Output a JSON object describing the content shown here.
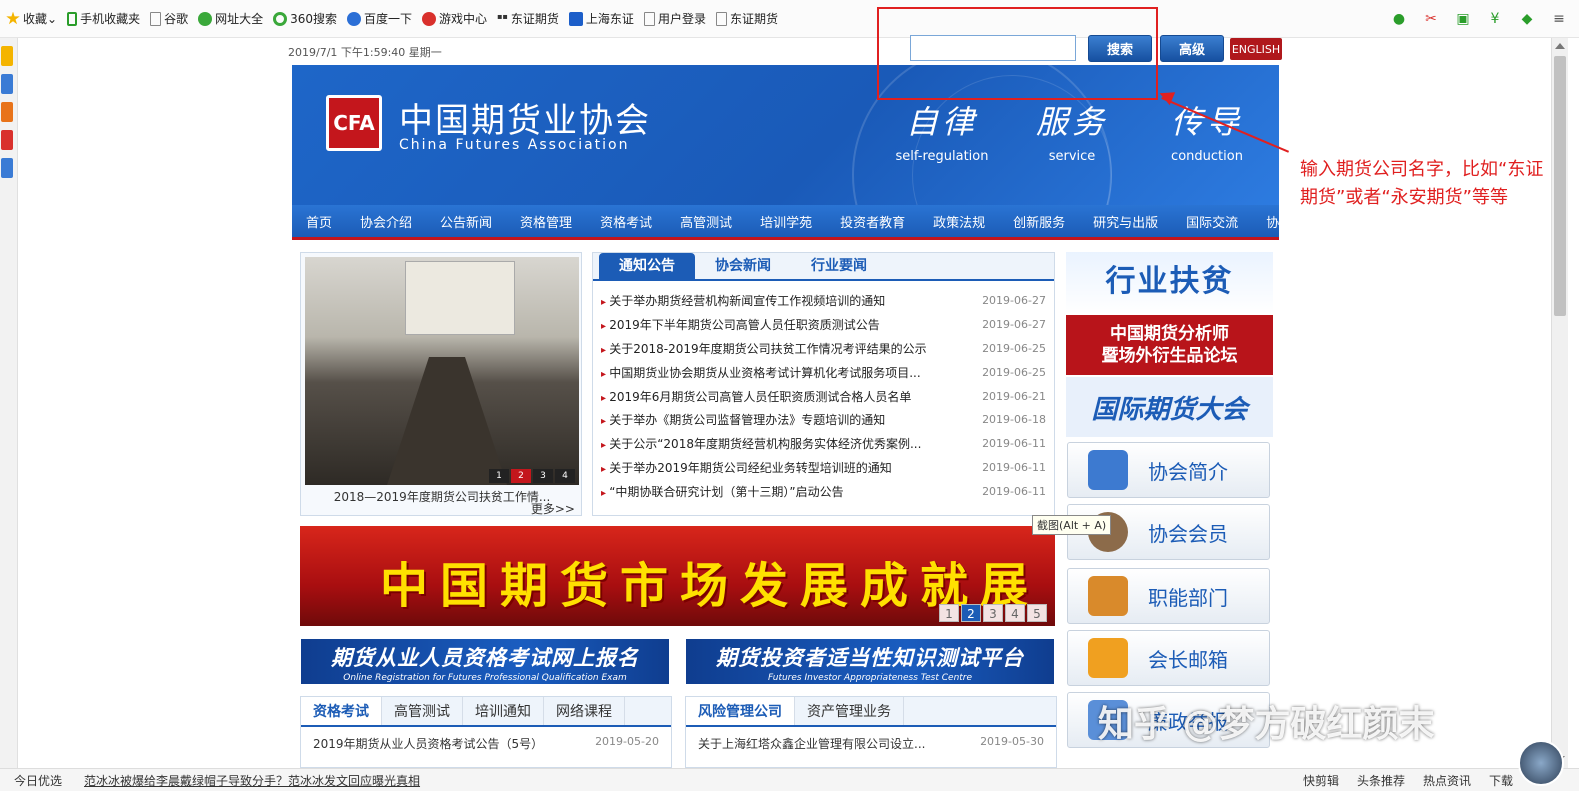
{
  "browser": {
    "favorites": [
      {
        "label": "收藏",
        "icon": "star-icon"
      },
      {
        "label": "手机收藏夹",
        "icon": "phone-icon"
      },
      {
        "label": "谷歌",
        "icon": "page-icon"
      },
      {
        "label": "网址大全",
        "icon": "plus-circle-icon"
      },
      {
        "label": "360搜索",
        "icon": "ring-icon"
      },
      {
        "label": "百度一下",
        "icon": "paw-icon"
      },
      {
        "label": "游戏中心",
        "icon": "game-icon"
      },
      {
        "label": "东证期货",
        "icon": "dz-icon"
      },
      {
        "label": "上海东证",
        "icon": "blue-square-icon"
      },
      {
        "label": "用户登录",
        "icon": "page-icon"
      },
      {
        "label": "东证期货",
        "icon": "page-icon"
      }
    ]
  },
  "site": {
    "datetime": "2019/7/1 下午1:59:40 星期一",
    "search_button": "搜索",
    "advanced_button": "高级",
    "english_button": "ENGLISH",
    "logo_mark": "CFA",
    "org_name_cn": "中国期货业协会",
    "org_name_en": "China Futures Association",
    "slogans": [
      {
        "cn": "自律",
        "en": "self-regulation"
      },
      {
        "cn": "服务",
        "en": "service"
      },
      {
        "cn": "传导",
        "en": "conduction"
      }
    ],
    "nav": [
      "首页",
      "协会介绍",
      "公告新闻",
      "资格管理",
      "资格考试",
      "高管测试",
      "培训学苑",
      "投资者教育",
      "政策法规",
      "创新服务",
      "研究与出版",
      "国际交流",
      "协会邮箱"
    ]
  },
  "feature": {
    "caption": "2018—2019年度期货公司扶贫工作情...",
    "more": "更多>>",
    "pager": [
      "1",
      "2",
      "3",
      "4"
    ],
    "active_page": "2"
  },
  "notices": {
    "tabs": [
      "通知公告",
      "协会新闻",
      "行业要闻"
    ],
    "items": [
      {
        "title": "关于举办期货经营机构新闻宣传工作视频培训的通知",
        "date": "2019-06-27"
      },
      {
        "title": "2019年下半年期货公司高管人员任职资质测试公告",
        "date": "2019-06-27"
      },
      {
        "title": "关于2018-2019年度期货公司扶贫工作情况考评结果的公示",
        "date": "2019-06-25"
      },
      {
        "title": "中国期货业协会期货从业资格考试计算机化考试服务项目...",
        "date": "2019-06-25"
      },
      {
        "title": "2019年6月期货公司高管人员任职资质测试合格人员名单",
        "date": "2019-06-21"
      },
      {
        "title": "关于举办《期货公司监督管理办法》专题培训的通知",
        "date": "2019-06-18"
      },
      {
        "title": "关于公示“2018年度期货经营机构服务实体经济优秀案例...",
        "date": "2019-06-11"
      },
      {
        "title": "关于举办2019年期货公司经纪业务转型培训班的通知",
        "date": "2019-06-11"
      },
      {
        "title": "“中期协联合研究计划（第十三期）”启动公告",
        "date": "2019-06-11"
      }
    ]
  },
  "banner": {
    "text": "中国期货市场发展成就展",
    "pager": [
      "1",
      "2",
      "3",
      "4",
      "5"
    ],
    "active_page": "2"
  },
  "reg_banners": [
    {
      "title": "期货从业人员资格考试网上报名",
      "subtitle": "Online Registration for Futures Professional Qualification Exam"
    },
    {
      "title": "期货投资者适当性知识测试平台",
      "subtitle": "Futures Investor Appropriateness Test Centre"
    }
  ],
  "exam_box": {
    "tabs": [
      "资格考试",
      "高管测试",
      "培训通知",
      "网络课程"
    ],
    "item": {
      "title": "2019年期货从业人员资格考试公告（5号）",
      "date": "2019-05-20"
    }
  },
  "risk_box": {
    "tabs": [
      "风险管理公司",
      "资产管理业务"
    ],
    "item": {
      "title": "关于上海红塔众鑫企业管理有限公司设立...",
      "date": "2019-05-30"
    }
  },
  "right_column": {
    "poverty": "行业扶贫",
    "analyst_line1": "中国期货分析师",
    "analyst_line2": "暨场外衍生品论坛",
    "intl": "国际期货大会",
    "menu": [
      {
        "label": "协会简介",
        "icon": "book-icon"
      },
      {
        "label": "协会会员",
        "icon": "person-icon"
      },
      {
        "label": "职能部门",
        "icon": "house-icon"
      },
      {
        "label": "会长邮箱",
        "icon": "envelope-icon"
      },
      {
        "label": "廉政举报",
        "icon": "report-icon"
      }
    ]
  },
  "annotation": {
    "text": "输入期货公司名字，比如“东证期货”或者“永安期货”等等"
  },
  "tooltip": "截图(Alt + A)",
  "watermark": "知乎 @梦方破红颜末",
  "statusbar": {
    "left": "今日优选",
    "news": "范冰冰被爆给李晨戴绿帽子导致分手？范冰冰发文回应曝光真相",
    "right": [
      "快剪辑",
      "头条推荐",
      "热点资讯",
      "下载"
    ]
  },
  "colors": {
    "brand_blue": "#1c5cb6",
    "brand_red": "#c4161c",
    "annotation_red": "#e02020"
  }
}
